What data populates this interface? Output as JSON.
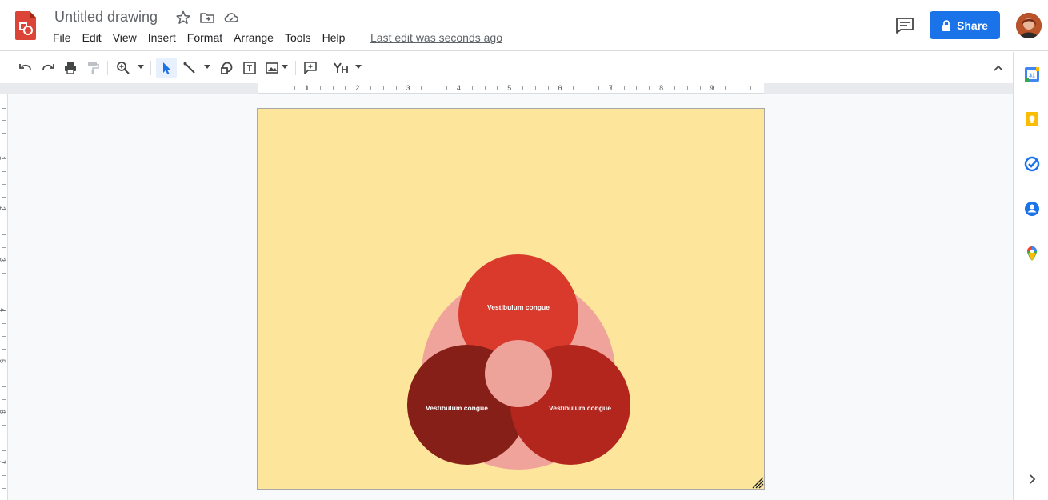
{
  "document": {
    "title": "Untitled drawing",
    "last_edit": "Last edit was seconds ago"
  },
  "menu": [
    {
      "id": "file",
      "label": "File"
    },
    {
      "id": "edit",
      "label": "Edit"
    },
    {
      "id": "view",
      "label": "View"
    },
    {
      "id": "insert",
      "label": "Insert"
    },
    {
      "id": "format",
      "label": "Format"
    },
    {
      "id": "arrange",
      "label": "Arrange"
    },
    {
      "id": "tools",
      "label": "Tools"
    },
    {
      "id": "help",
      "label": "Help"
    }
  ],
  "share": {
    "label": "Share"
  },
  "toolbar": {
    "icons": [
      "undo-icon",
      "redo-icon",
      "print-icon",
      "paint-format-icon",
      "zoom-icon",
      "select-icon",
      "line-icon",
      "shape-icon",
      "text-box-icon",
      "image-icon",
      "add-comment-icon",
      "word-art-icon",
      "collapse-icon"
    ],
    "active_tool": "select"
  },
  "ruler": {
    "horizontal_numbers": [
      "1",
      "2",
      "3",
      "4",
      "5",
      "6",
      "7",
      "8",
      "9"
    ],
    "vertical_numbers": [
      "1",
      "2",
      "3",
      "4",
      "5",
      "6",
      "7"
    ]
  },
  "drawing": {
    "page_color": "#fde59c",
    "venn": {
      "background_circle_color": "#f0a39a",
      "center_circle_color": "#eda29a",
      "circles": [
        {
          "id": "top",
          "label": "Vestibulum congue",
          "color": "#d93a2b"
        },
        {
          "id": "left",
          "label": "Vestibulum congue",
          "color": "#851f17"
        },
        {
          "id": "right",
          "label": "Vestibulum congue",
          "color": "#b3261e"
        }
      ]
    }
  },
  "side_panel": [
    "calendar-icon",
    "keep-icon",
    "tasks-icon",
    "contacts-icon",
    "maps-icon"
  ],
  "colors": {
    "accent": "#1a73e8",
    "app_logo": "#db4437"
  }
}
